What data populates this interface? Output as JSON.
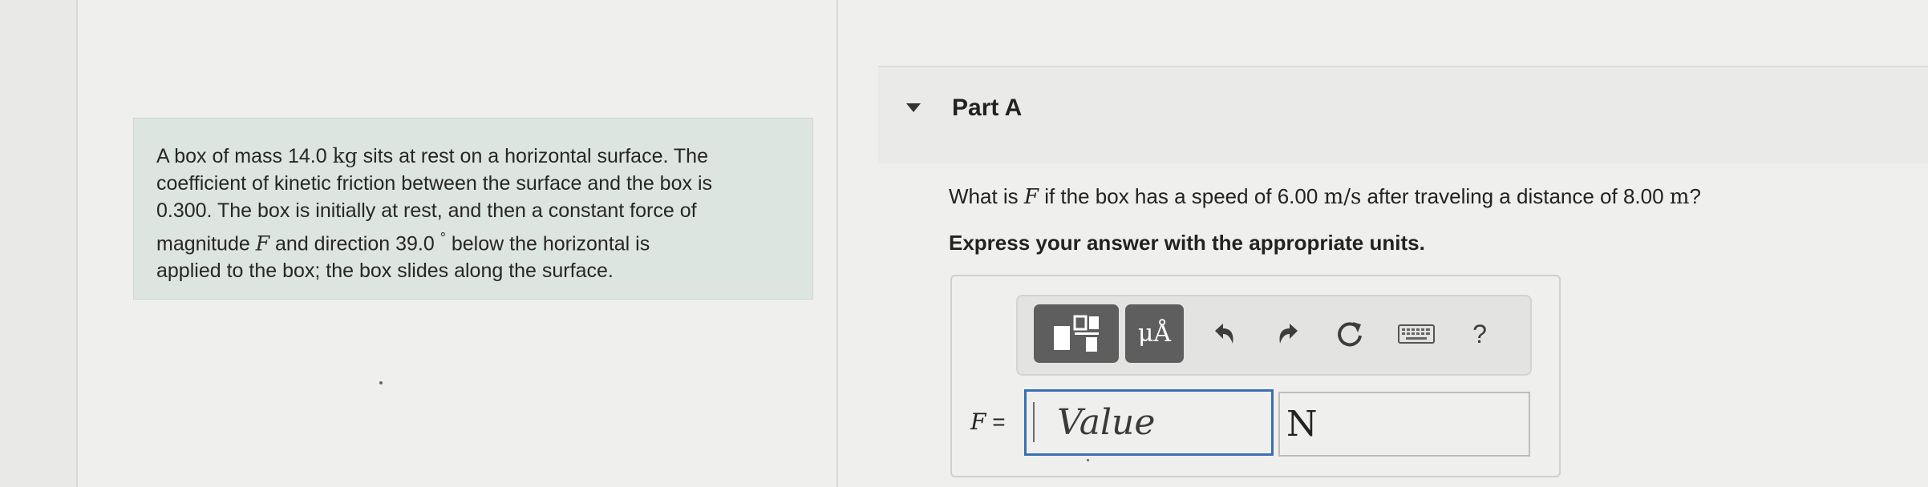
{
  "problem": {
    "lines": [
      [
        "A box of mass 14.0 ",
        "kg",
        " sits at rest on a horizontal surface. The"
      ],
      [
        "coefficient of kinetic friction between the surface and the box is"
      ],
      [
        "0.300. The box is initially at rest, and then a constant force of"
      ],
      [
        "magnitude ",
        "F",
        " and direction 39.0 ",
        "°",
        " below the horizontal is"
      ],
      [
        "applied to the box; the box slides along the surface."
      ]
    ]
  },
  "part": {
    "title": "Part A",
    "toggle_icon": "caret-down-icon",
    "question_pre": "What is ",
    "question_var": "F",
    "question_mid": " if the box has a speed of 6.00 ",
    "question_unit1": "m/s",
    "question_mid2": " after traveling a distance of 8.00 ",
    "question_unit2": "m",
    "question_end": "?",
    "instruction": "Express your answer with the appropriate units."
  },
  "toolbar": {
    "templates_icon": "templates-icon",
    "units_label": "μÅ",
    "undo_icon": "undo-icon",
    "redo_icon": "redo-icon",
    "reset_icon": "reset-icon",
    "keyboard_icon": "keyboard-icon",
    "help_label": "?"
  },
  "answer": {
    "variable": "F",
    "equals": " =",
    "value_placeholder": "Value",
    "units_value": "N"
  },
  "colors": {
    "problem_bg": "#dde5e1",
    "input_border": "#3a6fb3",
    "dark_button": "#5e5e5e"
  }
}
